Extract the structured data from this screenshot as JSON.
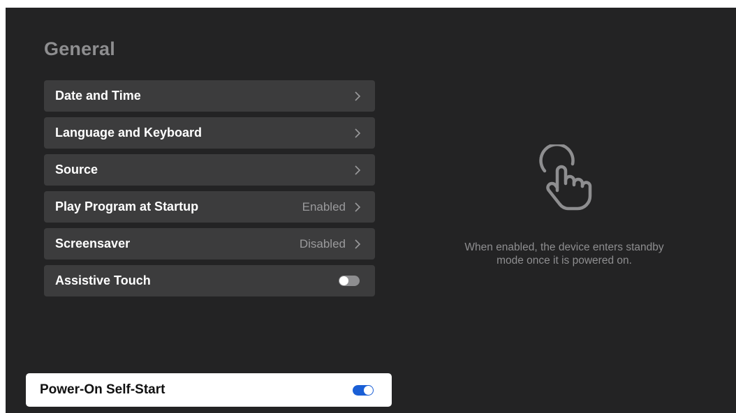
{
  "page": {
    "title": "General"
  },
  "menu": {
    "items": [
      {
        "label": "Date and Time",
        "value": "",
        "control": "chevron"
      },
      {
        "label": "Language and Keyboard",
        "value": "",
        "control": "chevron"
      },
      {
        "label": "Source",
        "value": "",
        "control": "chevron"
      },
      {
        "label": "Play Program at Startup",
        "value": "Enabled",
        "control": "chevron"
      },
      {
        "label": "Screensaver",
        "value": "Disabled",
        "control": "chevron"
      },
      {
        "label": "Assistive Touch",
        "value": "",
        "control": "toggle",
        "toggle_state": "off"
      },
      {
        "label": "Power-On Self-Start",
        "value": "",
        "control": "toggle",
        "toggle_state": "on",
        "focused": true
      }
    ]
  },
  "help": {
    "icon": "touch-hand-icon",
    "text_line1": "When enabled, the device enters standby",
    "text_line2": "mode once it is powered on."
  },
  "colors": {
    "background": "#232324",
    "item_background": "#3c3c3d",
    "focused_background": "#ffffff",
    "toggle_on": "#1a5fd6",
    "toggle_off": "#8e8e90",
    "muted_text": "#8e8e90"
  }
}
